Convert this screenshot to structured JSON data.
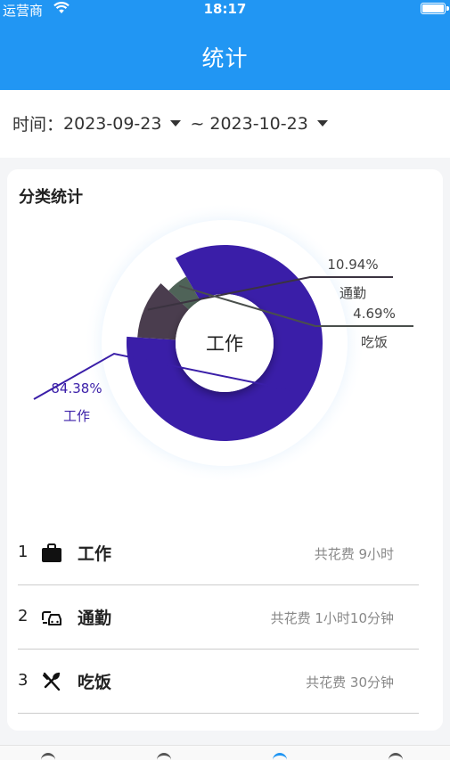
{
  "status": {
    "carrier": "运营商",
    "time": "18:17"
  },
  "header": {
    "title": "统计"
  },
  "date_range": {
    "label": "时间：",
    "start": "2023-09-23",
    "separator": "~",
    "end": "2023-10-23"
  },
  "card": {
    "title": "分类统计"
  },
  "colors": {
    "primary": "#2196f3",
    "work": "#3a1ea8",
    "commute": "#4a3d4e",
    "meal": "#4f6358"
  },
  "chart_data": {
    "type": "pie",
    "center_label": "工作",
    "slices": [
      {
        "label": "工作",
        "percent": 84.38,
        "percent_text": "84.38%"
      },
      {
        "label": "通勤",
        "percent": 10.94,
        "percent_text": "10.94%"
      },
      {
        "label": "吃饭",
        "percent": 4.69,
        "percent_text": "4.69%"
      }
    ]
  },
  "list": [
    {
      "index": "1",
      "icon": "briefcase-icon",
      "name": "工作",
      "cost": "共花费 9小时"
    },
    {
      "index": "2",
      "icon": "car-icon",
      "name": "通勤",
      "cost": "共花费 1小时10分钟"
    },
    {
      "index": "3",
      "icon": "utensils-icon",
      "name": "吃饭",
      "cost": "共花费 30分钟"
    }
  ]
}
